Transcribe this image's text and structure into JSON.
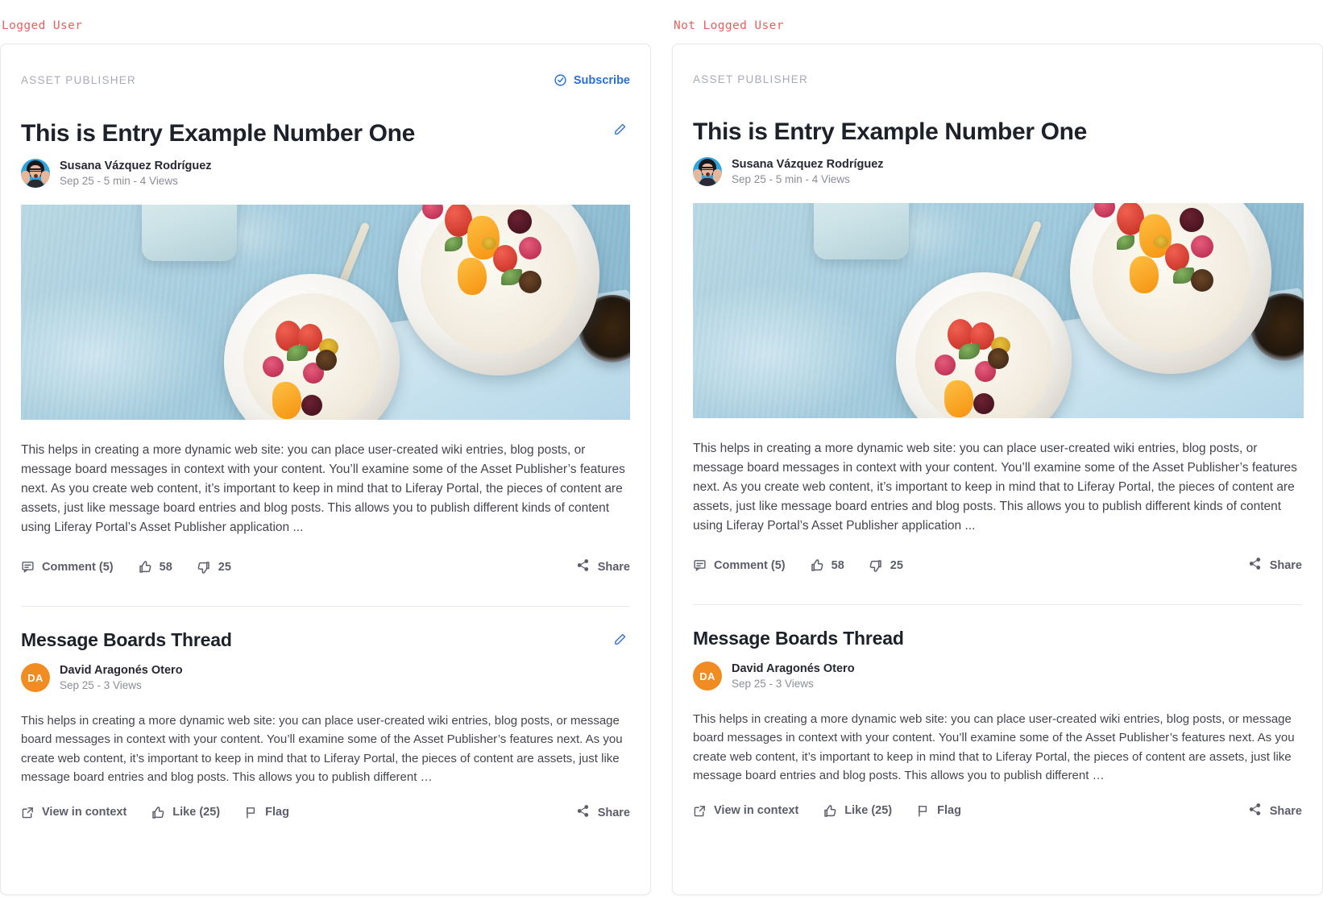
{
  "panels": [
    {
      "label": "Logged User",
      "kicker": "ASSET PUBLISHER",
      "subscribe_label": "Subscribe",
      "has_subscribe": true,
      "has_edit": true
    },
    {
      "label": "Not Logged User",
      "kicker": "ASSET PUBLISHER",
      "subscribe_label": "Subscribe",
      "has_subscribe": false,
      "has_edit": false
    }
  ],
  "entry": {
    "title": "This is Entry Example Number One",
    "author": "Susana Vázquez Rodríguez",
    "meta": "Sep 25 - 5 min - 4 Views",
    "body": "This helps in creating a more dynamic web site: you can place user-created wiki entries, blog posts, or message board messages in context with your content. You’ll examine some of the Asset Publisher’s features next. As you create web content, it’s important to keep in mind that to Liferay Portal, the pieces of content are assets, just like message board entries and blog posts. This allows you to publish different kinds of content using Liferay Portal’s Asset Publisher application ...",
    "actions": {
      "comment_label": "Comment (5)",
      "like_count": "58",
      "dislike_count": "25",
      "share_label": "Share"
    },
    "image_alt": "Two bowls of porridge with fresh fruit on a blue wooden table"
  },
  "thread": {
    "title": "Message Boards Thread",
    "author": "David Aragonés Otero",
    "author_initials": "DA",
    "meta": "Sep 25  -  3 Views",
    "body": "This helps in creating a more dynamic web site: you can place user-created wiki entries, blog posts, or message board messages in context with your content. You’ll examine some of the Asset Publisher’s features next. As you create web content, it’s important to keep in mind that to Liferay Portal, the pieces of content are assets, just like message board entries and blog posts. This allows you to publish different …",
    "actions": {
      "view_in_context_label": "View in context",
      "like_label": "Like (25)",
      "flag_label": "Flag",
      "share_label": "Share"
    }
  },
  "colors": {
    "label_red": "#e8615f",
    "link_blue": "#2b6ed4",
    "kicker_grey": "#a7a9bc",
    "text_dark": "#1d2129",
    "body_grey": "#44454f",
    "action_grey": "#5c5d6b",
    "avatar_orange": "#f08c22",
    "card_border": "#e7e7ed"
  }
}
